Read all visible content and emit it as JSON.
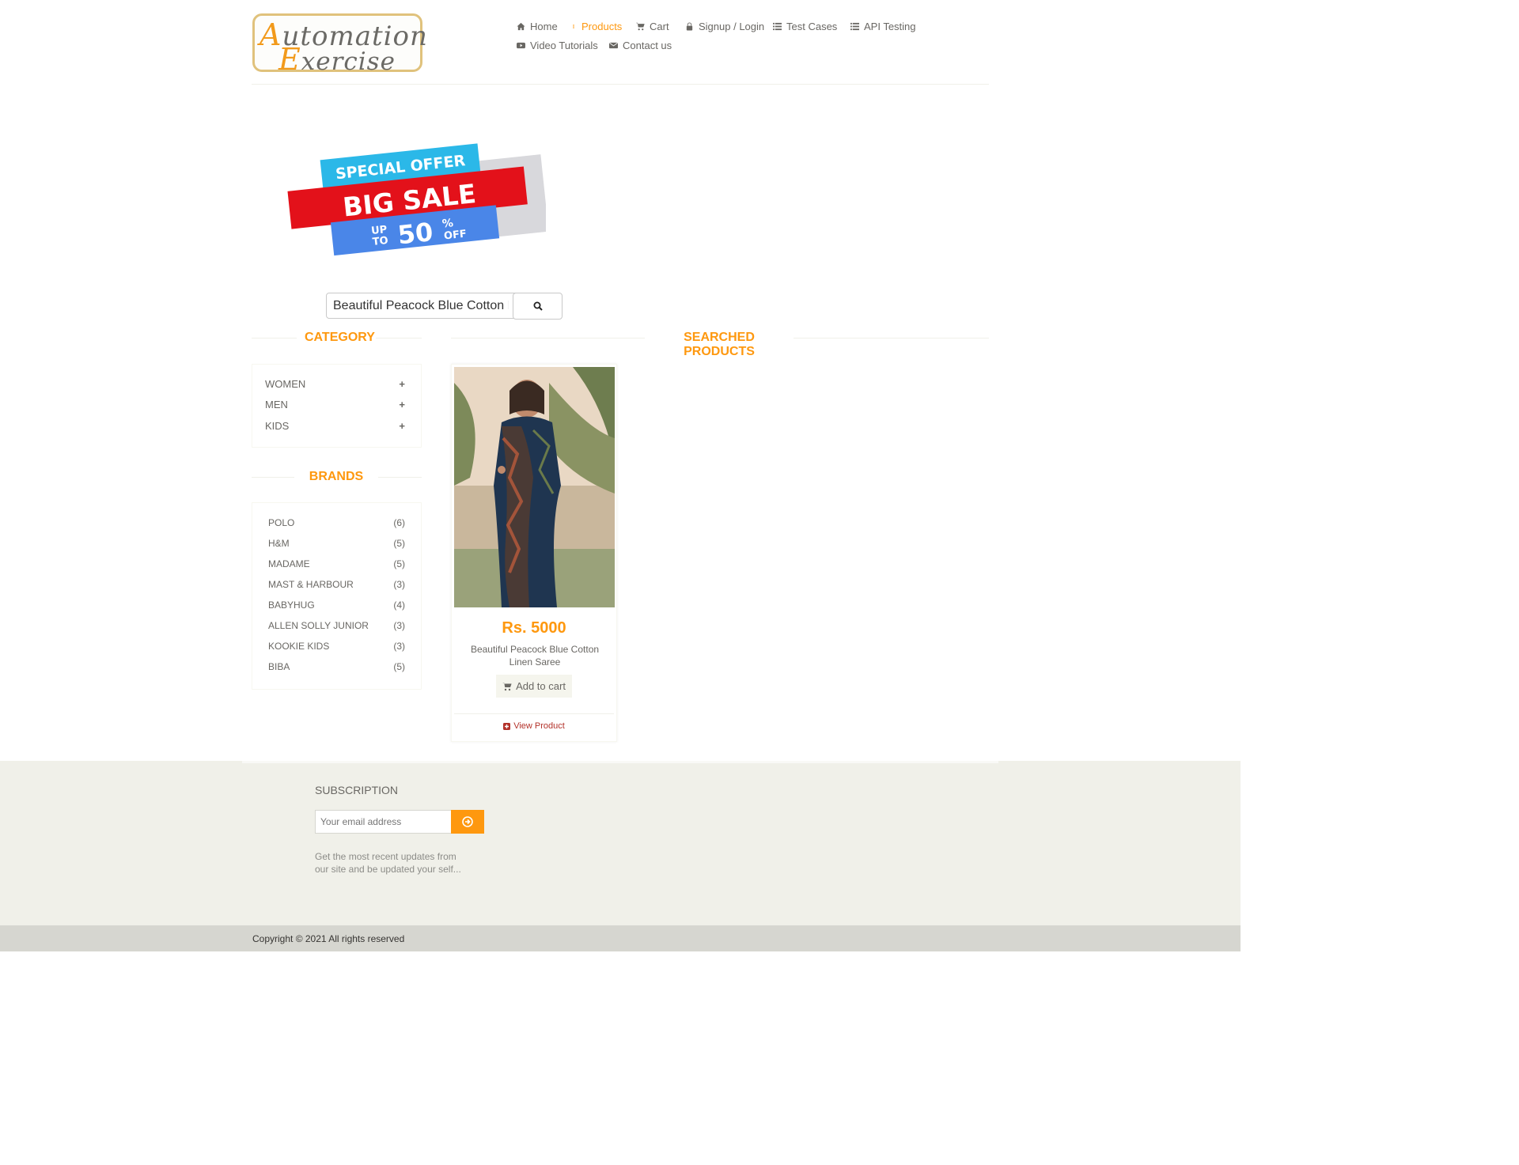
{
  "header": {
    "logo_line1_cap": "A",
    "logo_line1_rest": "utomation",
    "logo_line2_cap": "E",
    "logo_line2_rest": "xercise",
    "nav": [
      {
        "label": "Home",
        "icon": "home-icon"
      },
      {
        "label": "Products",
        "icon": "products-icon",
        "active": true
      },
      {
        "label": "Cart",
        "icon": "cart-icon"
      },
      {
        "label": "Signup / Login",
        "icon": "lock-icon"
      },
      {
        "label": "Test Cases",
        "icon": "list-icon"
      },
      {
        "label": "API Testing",
        "icon": "list-icon"
      },
      {
        "label": "Video Tutorials",
        "icon": "youtube-icon"
      },
      {
        "label": "Contact us",
        "icon": "envelope-icon"
      }
    ]
  },
  "banner": {
    "line1": "SPECIAL OFFER",
    "line2": "BIG SALE",
    "line3_up": "UP",
    "line3_to": "TO",
    "line3_amount": "50",
    "line3_pct": "%",
    "line3_off": "OFF"
  },
  "search": {
    "value": "Beautiful Peacock Blue Cotton Linen Saree"
  },
  "sidebar": {
    "category_title": "CATEGORY",
    "categories": [
      {
        "label": "WOMEN"
      },
      {
        "label": "MEN"
      },
      {
        "label": "KIDS"
      }
    ],
    "brands_title": "BRANDS",
    "brands": [
      {
        "label": "POLO",
        "count": "(6)"
      },
      {
        "label": "H&M",
        "count": "(5)"
      },
      {
        "label": "MADAME",
        "count": "(5)"
      },
      {
        "label": "MAST & HARBOUR",
        "count": "(3)"
      },
      {
        "label": "BABYHUG",
        "count": "(4)"
      },
      {
        "label": "ALLEN SOLLY JUNIOR",
        "count": "(3)"
      },
      {
        "label": "KOOKIE KIDS",
        "count": "(3)"
      },
      {
        "label": "BIBA",
        "count": "(5)"
      }
    ]
  },
  "results": {
    "title": "SEARCHED PRODUCTS",
    "product": {
      "price": "Rs. 5000",
      "name": "Beautiful Peacock Blue Cotton Linen Saree",
      "add_to_cart": "Add to cart",
      "view_product": "View Product"
    }
  },
  "footer": {
    "subscription_title": "SUBSCRIPTION",
    "email_placeholder": "Your email address",
    "subscription_text": "Get the most recent updates from our site and be updated your self...",
    "copyright": "Copyright © 2021 All rights reserved"
  },
  "colors": {
    "accent": "#fe980f",
    "text": "#696763",
    "footer_bg": "#f0f0e9",
    "link_red": "#b3322a"
  }
}
